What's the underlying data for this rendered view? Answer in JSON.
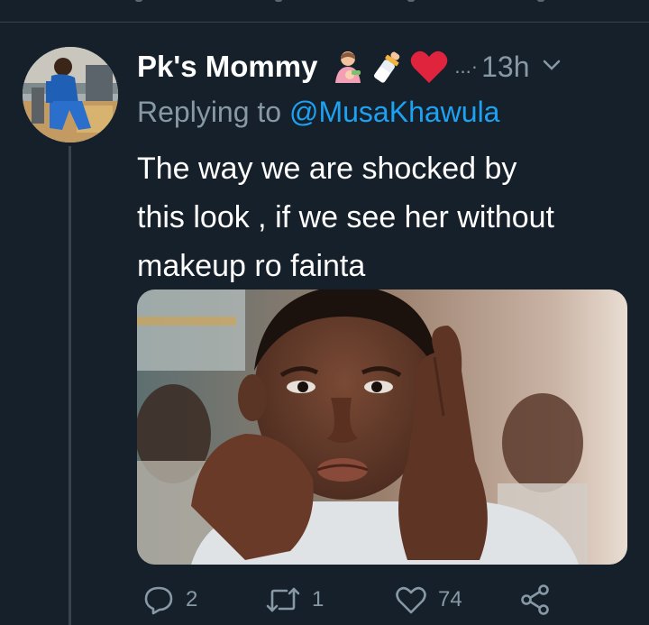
{
  "tweet": {
    "author_name": "Pk's Mommy",
    "emojis": [
      "mother-feeding-baby-emoji",
      "baby-bottle-emoji",
      "red-heart-emoji"
    ],
    "dots": "...·",
    "timestamp": "13h",
    "replying_prefix": "Replying to ",
    "replying_handle": "@MusaKhawula",
    "text_lines": [
      "The way we are shocked by",
      "this look , if we see her without",
      "makeup ro fainta"
    ]
  },
  "actions": {
    "reply_count": "2",
    "retweet_count": "1",
    "like_count": "74"
  },
  "colors": {
    "background": "#15202b",
    "muted": "#8899a6",
    "link": "#1da1f2",
    "divider": "#38444d"
  }
}
